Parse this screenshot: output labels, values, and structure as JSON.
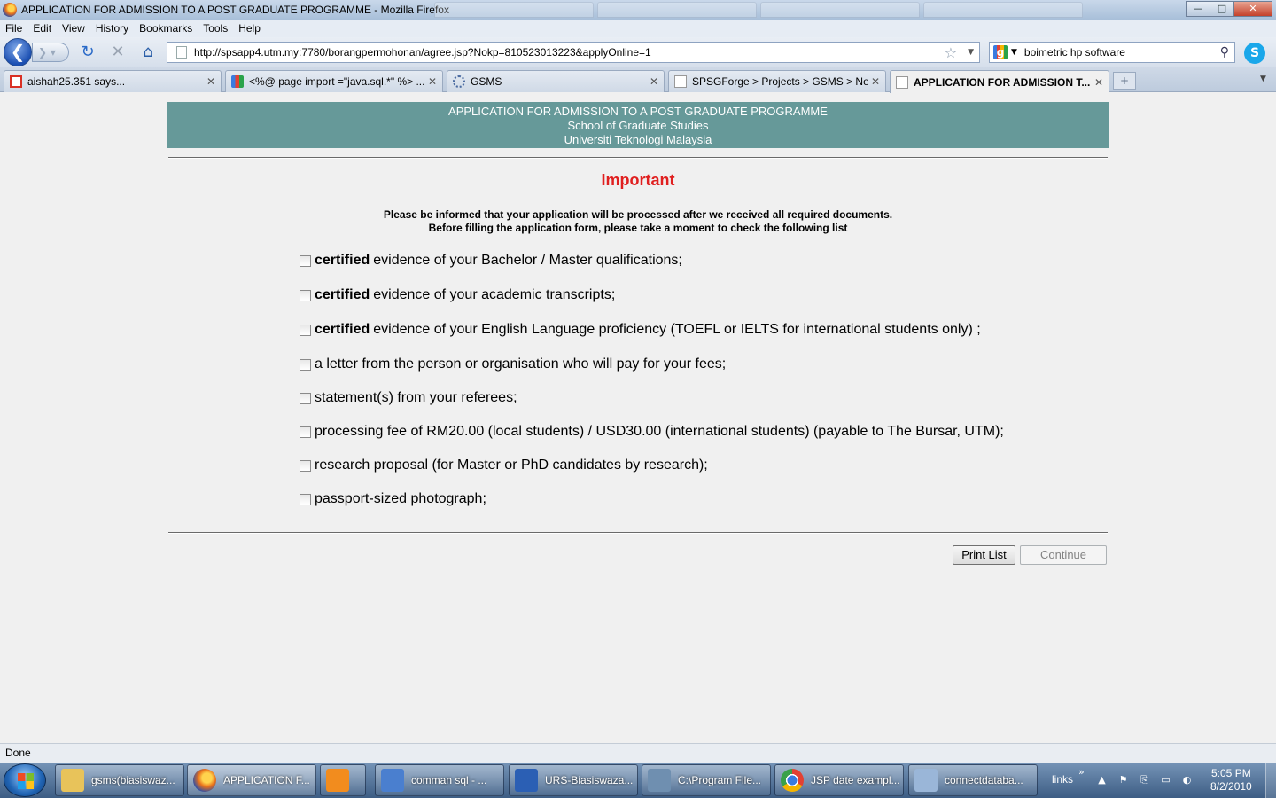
{
  "window": {
    "title": "APPLICATION FOR ADMISSION TO A POST GRADUATE PROGRAMME - Mozilla Firefox",
    "controls": {
      "minimize": "—",
      "maximize": "□",
      "close": "✕"
    }
  },
  "menubar": {
    "items": [
      "File",
      "Edit",
      "View",
      "History",
      "Bookmarks",
      "Tools",
      "Help"
    ]
  },
  "navbar": {
    "url": "http://spsapp4.utm.my:7780/borangpermohonan/agree.jsp?Nokp=810523013223&applyOnline=1",
    "search_value": "boimetric hp software",
    "back_glyph": "❮",
    "forward_glyph": "❯ ▾",
    "reload_glyph": "↻",
    "stop_glyph": "✕",
    "home_glyph": "⌂",
    "star_glyph": "☆",
    "dropdown_glyph": "▼",
    "search_glyph": "⚲",
    "google_glyph": "g",
    "skype_glyph": "S"
  },
  "tabs": [
    {
      "label": "aishah25.351 says...",
      "close": "✕",
      "active": false
    },
    {
      "label": "<%@ page import =\"java.sql.*\" %> ...",
      "close": "✕",
      "active": false
    },
    {
      "label": "GSMS",
      "close": "✕",
      "active": false
    },
    {
      "label": "SPSGForge > Projects > GSMS > Ne...",
      "close": "✕",
      "active": false
    },
    {
      "label": "APPLICATION FOR ADMISSION T...",
      "close": "✕",
      "active": true
    }
  ],
  "tabstrip": {
    "new_tab": "+",
    "list": "▼"
  },
  "page": {
    "header": {
      "line1": "APPLICATION FOR ADMISSION TO A POST GRADUATE PROGRAMME",
      "line2": "School of Graduate Studies",
      "line3": "Universiti Teknologi Malaysia"
    },
    "heading": "Important",
    "info_line1": "Please be informed that your application will be processed after we received all required documents.",
    "info_line2": "Before filling the application form, please take a moment to check the following list",
    "checklist": [
      {
        "bold": "certified",
        "text": "evidence of your Bachelor / Master qualifications;",
        "checked": false
      },
      {
        "bold": "certified",
        "text": "evidence of your academic transcripts;",
        "checked": false
      },
      {
        "bold": "certified",
        "text": "evidence of your English Language proficiency (TOEFL or IELTS for international students only) ;",
        "checked": false
      },
      {
        "bold": "",
        "text": "a letter from the person or organisation who will pay for your fees;",
        "checked": false
      },
      {
        "bold": "",
        "text": "statement(s) from your referees;",
        "checked": false
      },
      {
        "bold": "",
        "text": "processing fee of RM20.00 (local students) / USD30.00 (international students) (payable to The Bursar, UTM);",
        "checked": false
      },
      {
        "bold": "",
        "text": "research proposal (for Master or PhD candidates by research);",
        "checked": false
      },
      {
        "bold": "",
        "text": "passport-sized photograph;",
        "checked": false
      }
    ],
    "buttons": {
      "print": "Print List",
      "continue": "Continue"
    }
  },
  "statusbar": {
    "text": "Done"
  },
  "taskbar": {
    "items": [
      {
        "label": "gsms(biasiswaz...",
        "icon": "folder-icon",
        "color": "#e8c35a"
      },
      {
        "label": "APPLICATION F...",
        "icon": "firefox-icon",
        "color": "#e8701a",
        "active": true
      },
      {
        "label": "",
        "icon": "media-player-icon",
        "color": "#f28c1e"
      },
      {
        "label": "comman sql - ...",
        "icon": "document-icon",
        "color": "#4a7fcf"
      },
      {
        "label": "URS-Biasiswaza...",
        "icon": "word-icon",
        "color": "#2b5fb4"
      },
      {
        "label": "C:\\Program File...",
        "icon": "console-icon",
        "color": "#6f8fb0"
      },
      {
        "label": "JSP date exampl...",
        "icon": "chrome-icon",
        "color": "#3aa14a"
      },
      {
        "label": "connectdataba...",
        "icon": "cube-icon",
        "color": "#9ab6d8"
      }
    ],
    "links": "links",
    "links_chevron": "»",
    "tray": [
      "▲",
      "⚑",
      "⎘",
      "▭",
      "◐"
    ],
    "time": "5:05 PM",
    "date": "8/2/2010"
  }
}
